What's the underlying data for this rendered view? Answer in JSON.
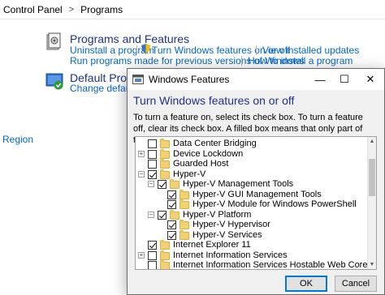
{
  "breadcrumb": {
    "root": "Control Panel",
    "separator": ">",
    "current": "Programs"
  },
  "programs_features": {
    "title": "Programs and Features",
    "links": [
      "Uninstall a program",
      "Turn Windows features on or off",
      "View installed updates",
      "Run programs made for previous versions of Windows",
      "How to install a program"
    ]
  },
  "default_programs": {
    "title": "Default Programs",
    "links": [
      "Change default se"
    ]
  },
  "sidebar": {
    "region_link": "Region"
  },
  "dialog": {
    "title": "Windows Features",
    "controls": {
      "minimize": "—",
      "maximize": "☐",
      "close": "✕"
    },
    "heading": "Turn Windows features on or off",
    "description": "To turn a feature on, select its check box. To turn a feature off, clear its check box. A filled box means that only part of the feature is turned on.",
    "features": [
      {
        "label": "Data Center Bridging",
        "level": 0,
        "expander": "",
        "checked": false
      },
      {
        "label": "Device Lockdown",
        "level": 0,
        "expander": "+",
        "checked": false
      },
      {
        "label": "Guarded Host",
        "level": 0,
        "expander": "",
        "checked": false
      },
      {
        "label": "Hyper-V",
        "level": 0,
        "expander": "−",
        "checked": true
      },
      {
        "label": "Hyper-V Management Tools",
        "level": 1,
        "expander": "−",
        "checked": true
      },
      {
        "label": "Hyper-V GUI Management Tools",
        "level": 2,
        "expander": "",
        "checked": true
      },
      {
        "label": "Hyper-V Module for Windows PowerShell",
        "level": 2,
        "expander": "",
        "checked": true
      },
      {
        "label": "Hyper-V Platform",
        "level": 1,
        "expander": "−",
        "checked": true
      },
      {
        "label": "Hyper-V Hypervisor",
        "level": 2,
        "expander": "",
        "checked": true
      },
      {
        "label": "Hyper-V Services",
        "level": 2,
        "expander": "",
        "checked": true
      },
      {
        "label": "Internet Explorer 11",
        "level": 0,
        "expander": "",
        "checked": true
      },
      {
        "label": "Internet Information Services",
        "level": 0,
        "expander": "+",
        "checked": false
      },
      {
        "label": "Internet Information Services Hostable Web Core",
        "level": 0,
        "expander": "",
        "checked": false
      }
    ],
    "ok_label": "OK",
    "cancel_label": "Cancel"
  },
  "colors": {
    "link": "#0066cc",
    "heading": "#1e3287",
    "folder": "#f3d070"
  }
}
